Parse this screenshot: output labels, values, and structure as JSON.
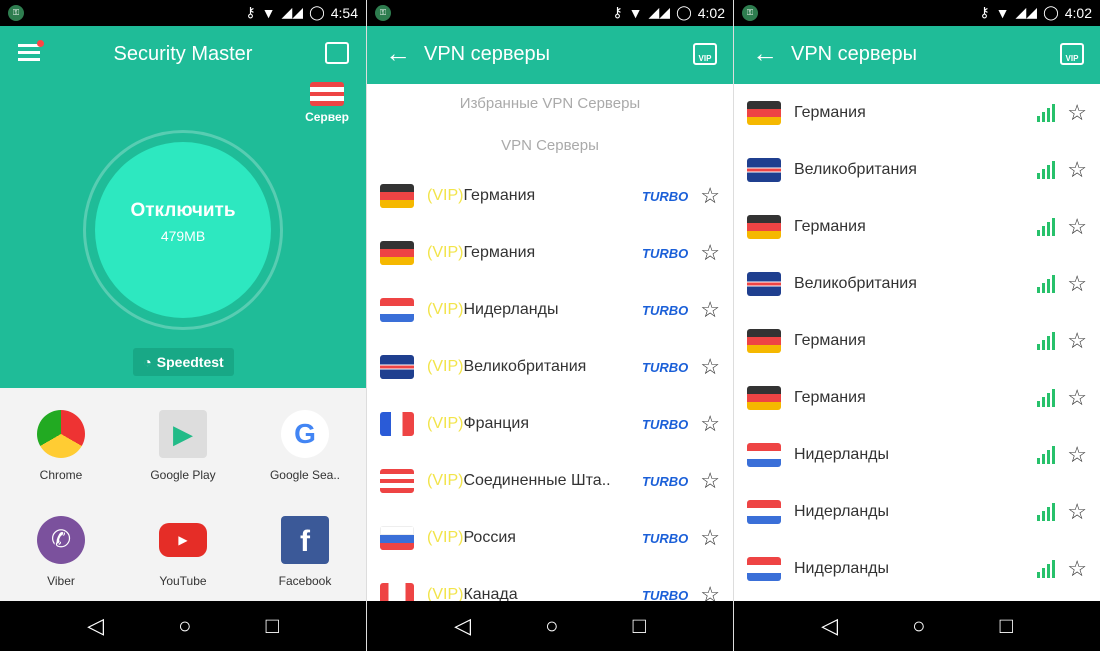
{
  "panels": [
    {
      "time": "4:54",
      "title": "Security Master",
      "server_label": "Сервер",
      "disconnect_label": "Отключить",
      "data_used": "479MB",
      "speedtest_label": "Speedtest",
      "apps": [
        {
          "label": "Chrome",
          "icon": "chrome-icon"
        },
        {
          "label": "Google Play",
          "icon": "google-play-icon"
        },
        {
          "label": "Google Sea..",
          "icon": "google-search-icon"
        },
        {
          "label": "Viber",
          "icon": "viber-icon"
        },
        {
          "label": "YouTube",
          "icon": "youtube-icon"
        },
        {
          "label": "Facebook",
          "icon": "facebook-icon"
        }
      ]
    },
    {
      "time": "4:02",
      "title": "VPN серверы",
      "favorites_heading": "Избранные VPN Серверы",
      "servers_heading": "VPN Серверы",
      "vip_prefix": "(VIP)",
      "turbo_label": "TURBO",
      "servers": [
        {
          "name": "Германия",
          "flag": "de"
        },
        {
          "name": "Германия",
          "flag": "de"
        },
        {
          "name": "Нидерланды",
          "flag": "nl"
        },
        {
          "name": "Великобритания",
          "flag": "gb"
        },
        {
          "name": "Франция",
          "flag": "fr"
        },
        {
          "name": "Соединенные Шта..",
          "flag": "us"
        },
        {
          "name": "Россия",
          "flag": "ru"
        },
        {
          "name": "Канада",
          "flag": "ca"
        }
      ]
    },
    {
      "time": "4:02",
      "title": "VPN серверы",
      "servers": [
        {
          "name": "Германия",
          "flag": "de"
        },
        {
          "name": "Великобритания",
          "flag": "gb"
        },
        {
          "name": "Германия",
          "flag": "de"
        },
        {
          "name": "Великобритания",
          "flag": "gb"
        },
        {
          "name": "Германия",
          "flag": "de"
        },
        {
          "name": "Германия",
          "flag": "de"
        },
        {
          "name": "Нидерланды",
          "flag": "nl"
        },
        {
          "name": "Нидерланды",
          "flag": "nl"
        },
        {
          "name": "Нидерланды",
          "flag": "nl"
        }
      ]
    }
  ],
  "colors": {
    "accent": "#1fbc98",
    "turbo": "#1a5fd8",
    "vip": "#f2e44a",
    "signal": "#27c16b"
  }
}
